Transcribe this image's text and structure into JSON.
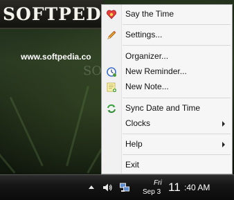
{
  "desktop": {
    "logo_text": "SOFTPED",
    "site_url": "www.softpedia.co",
    "watermark": "SOFT"
  },
  "menu": {
    "items": [
      {
        "label": "Say the Time",
        "icon": "clock-heart-icon",
        "submenu": false
      },
      {
        "label": "Settings...",
        "icon": "pencil-icon",
        "submenu": false
      },
      {
        "label": "Organizer...",
        "icon": "",
        "submenu": false
      },
      {
        "label": "New Reminder...",
        "icon": "reminder-clock-icon",
        "submenu": false
      },
      {
        "label": "New Note...",
        "icon": "note-icon",
        "submenu": false
      },
      {
        "label": "Sync Date and Time",
        "icon": "sync-arrows-icon",
        "submenu": false
      },
      {
        "label": "Clocks",
        "icon": "",
        "submenu": true
      },
      {
        "label": "Help",
        "icon": "",
        "submenu": true
      },
      {
        "label": "Exit",
        "icon": "",
        "submenu": false
      }
    ]
  },
  "taskbar": {
    "tray_icons": [
      "show-hidden-icons-arrow",
      "volume-icon",
      "network-icon"
    ],
    "clock": {
      "day": "Fri",
      "date": "Sep 3",
      "hour": "11",
      "rest": ":40 AM"
    }
  },
  "colors": {
    "menu_background": "#f6f6f6",
    "menu_border": "#9a9a9a",
    "taskbar": "#151515"
  }
}
